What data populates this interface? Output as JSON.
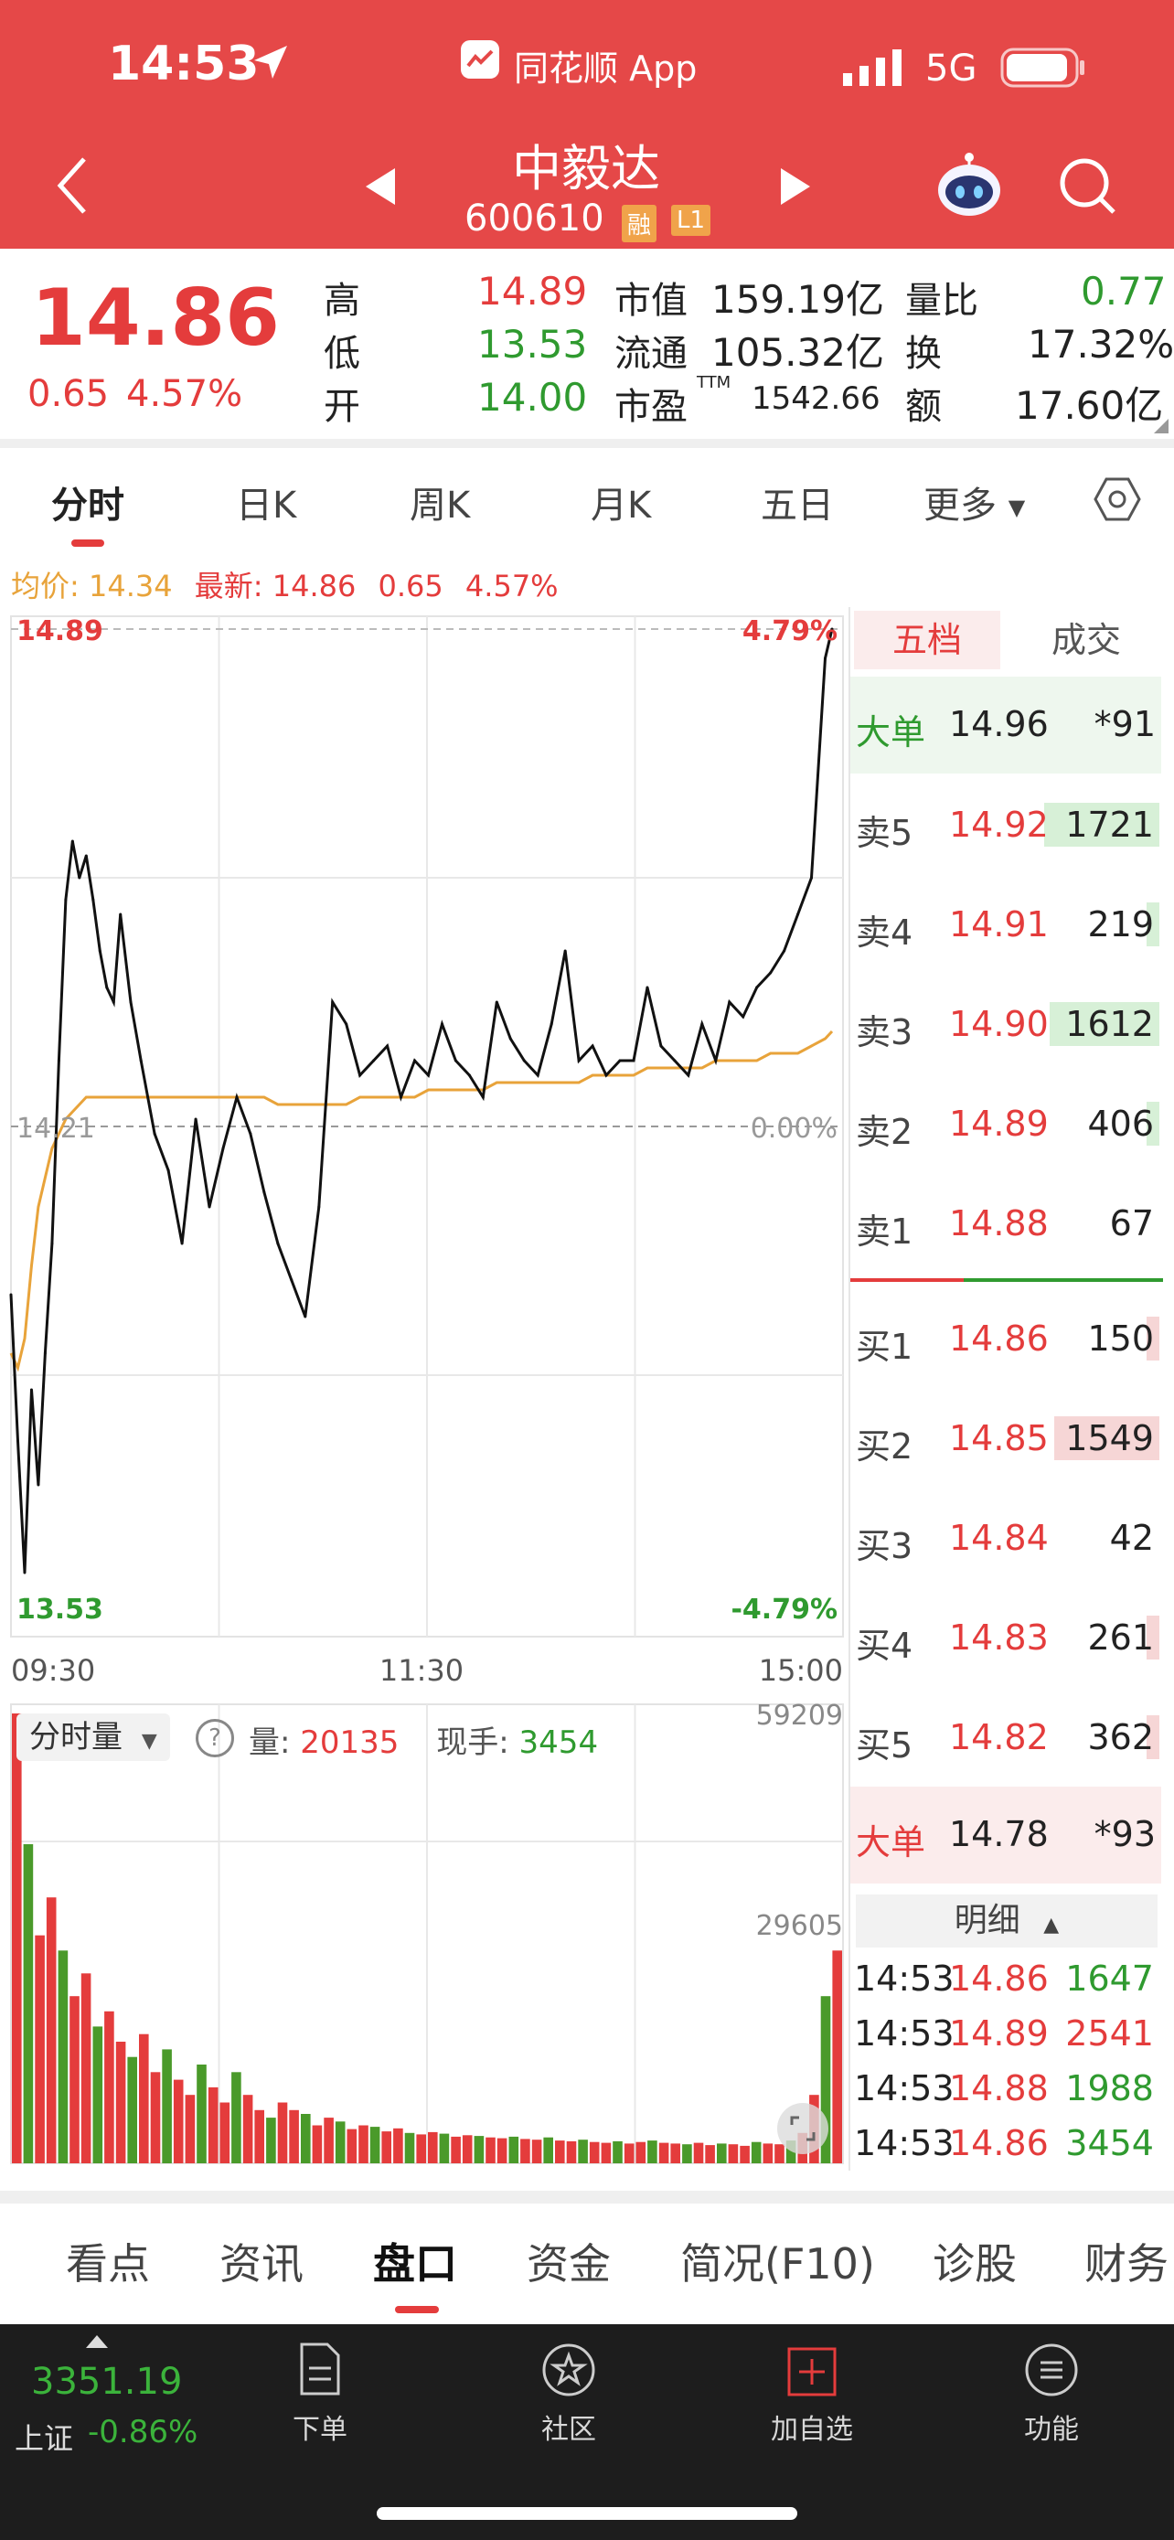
{
  "status_bar": {
    "time": "14:53",
    "app_label": "同花顺 App",
    "network": "5G"
  },
  "nav": {
    "stock_name": "中毅达",
    "stock_code": "600610",
    "badge_margin": "融",
    "badge_level": "L1"
  },
  "quote": {
    "price": "14.86",
    "change": "0.65",
    "change_pct": "4.57%",
    "high_label": "高",
    "high": "14.89",
    "low_label": "低",
    "low": "13.53",
    "open_label": "开",
    "open": "14.00",
    "mcap_label": "市值",
    "mcap": "159.19亿",
    "float_label": "流通",
    "float": "105.32亿",
    "pe_label": "市盈",
    "pe_sup": "TTM",
    "pe": "1542.66",
    "vr_label": "量比",
    "vr": "0.77",
    "turnover_label": "换",
    "turnover": "17.32%",
    "amount_label": "额",
    "amount": "17.60亿"
  },
  "chart_tabs": [
    "分时",
    "日K",
    "周K",
    "月K",
    "五日",
    "更多"
  ],
  "info_line": {
    "avg_label": "均价:",
    "avg": "14.34",
    "latest_label": "最新:",
    "latest": "14.86",
    "chg": "0.65",
    "pct": "4.57%"
  },
  "chart_data": {
    "type": "line",
    "price_axis": {
      "top": "14.89",
      "mid": "14.21",
      "bottom": "13.53",
      "pct_top": "4.79%",
      "pct_mid": "0.00%",
      "pct_bottom": "-4.79%",
      "ylim": [
        13.53,
        14.89
      ]
    },
    "time_labels": [
      "09:30",
      "11:30",
      "15:00"
    ],
    "x": [
      0,
      2,
      4,
      6,
      8,
      10,
      12,
      14,
      16,
      18,
      20,
      22,
      24,
      26,
      28,
      30,
      32,
      35,
      38,
      42,
      46,
      50,
      54,
      58,
      62,
      66,
      70,
      74,
      78,
      82,
      86,
      90,
      94,
      98,
      102,
      106,
      110,
      114,
      118,
      122,
      126,
      130,
      134,
      138,
      142,
      146,
      150,
      154,
      158,
      162,
      166,
      170,
      174,
      178,
      182,
      186,
      190,
      194,
      198,
      202,
      206,
      210,
      214,
      218,
      222,
      226,
      230,
      234,
      238,
      240
    ],
    "price": [
      13.98,
      13.78,
      13.6,
      13.85,
      13.72,
      13.9,
      14.05,
      14.3,
      14.52,
      14.6,
      14.55,
      14.58,
      14.52,
      14.45,
      14.4,
      14.38,
      14.5,
      14.38,
      14.3,
      14.2,
      14.15,
      14.05,
      14.22,
      14.1,
      14.18,
      14.25,
      14.2,
      14.12,
      14.05,
      14.0,
      13.95,
      14.1,
      14.38,
      14.35,
      14.28,
      14.3,
      14.32,
      14.25,
      14.3,
      14.28,
      14.35,
      14.3,
      14.28,
      14.25,
      14.38,
      14.33,
      14.3,
      14.28,
      14.35,
      14.45,
      14.3,
      14.32,
      14.28,
      14.3,
      14.3,
      14.4,
      14.32,
      14.3,
      14.28,
      14.35,
      14.3,
      14.38,
      14.36,
      14.4,
      14.42,
      14.45,
      14.5,
      14.55,
      14.85,
      14.89
    ],
    "avg": [
      13.9,
      13.88,
      13.92,
      14.02,
      14.1,
      14.14,
      14.18,
      14.2,
      14.22,
      14.23,
      14.24,
      14.25,
      14.25,
      14.25,
      14.25,
      14.25,
      14.25,
      14.25,
      14.25,
      14.25,
      14.25,
      14.25,
      14.25,
      14.25,
      14.25,
      14.25,
      14.25,
      14.25,
      14.24,
      14.24,
      14.24,
      14.24,
      14.24,
      14.24,
      14.25,
      14.25,
      14.25,
      14.25,
      14.25,
      14.26,
      14.26,
      14.26,
      14.26,
      14.26,
      14.27,
      14.27,
      14.27,
      14.27,
      14.27,
      14.27,
      14.27,
      14.28,
      14.28,
      14.28,
      14.28,
      14.29,
      14.29,
      14.29,
      14.29,
      14.29,
      14.3,
      14.3,
      14.3,
      14.3,
      14.31,
      14.31,
      14.31,
      14.32,
      14.33,
      14.34
    ],
    "price_series_name": "最新",
    "avg_series_name": "均价",
    "volume": {
      "label": "分时量",
      "vol_label": "量:",
      "vol": "20135",
      "hand_label": "现手:",
      "hand": "3454",
      "ymax": "59209",
      "ymid": "29605",
      "ylim": [
        0,
        59209
      ],
      "values": [
        59209,
        42000,
        30000,
        35000,
        28000,
        22000,
        25000,
        18000,
        20000,
        16000,
        14000,
        17000,
        12000,
        15000,
        11000,
        9000,
        13000,
        10000,
        8000,
        12000,
        9000,
        7000,
        6000,
        8000,
        7000,
        6500,
        5000,
        6000,
        5500,
        4500,
        5000,
        4800,
        4200,
        4600,
        4000,
        3800,
        4100,
        3900,
        3500,
        3700,
        3600,
        3400,
        3300,
        3500,
        3200,
        3100,
        3400,
        3000,
        2900,
        3100,
        2800,
        2700,
        2900,
        2600,
        2800,
        3000,
        2700,
        2600,
        2500,
        2700,
        2400,
        2600,
        2500,
        2300,
        2800,
        2600,
        2500,
        3000,
        4000,
        9000,
        22000,
        28000
      ],
      "colors_up": "#e43c3c",
      "colors_down": "#4a9a2a"
    }
  },
  "orderbook": {
    "tabs": [
      "五档",
      "成交"
    ],
    "big_sell": {
      "label": "大单",
      "price": "14.96",
      "qty": "*91"
    },
    "sells": [
      {
        "label": "卖5",
        "price": "14.92",
        "qty": "1721",
        "bar": 0.55
      },
      {
        "label": "卖4",
        "price": "14.91",
        "qty": "219",
        "bar": 0.06
      },
      {
        "label": "卖3",
        "price": "14.90",
        "qty": "1612",
        "bar": 0.52
      },
      {
        "label": "卖2",
        "price": "14.89",
        "qty": "406",
        "bar": 0.06
      },
      {
        "label": "卖1",
        "price": "14.88",
        "qty": "67",
        "bar": 0.0
      }
    ],
    "buys": [
      {
        "label": "买1",
        "price": "14.86",
        "qty": "150",
        "bar": 0.06
      },
      {
        "label": "买2",
        "price": "14.85",
        "qty": "1549",
        "bar": 0.5
      },
      {
        "label": "买3",
        "price": "14.84",
        "qty": "42",
        "bar": 0.0
      },
      {
        "label": "买4",
        "price": "14.83",
        "qty": "261",
        "bar": 0.06
      },
      {
        "label": "买5",
        "price": "14.82",
        "qty": "362",
        "bar": 0.06
      }
    ],
    "big_buy": {
      "label": "大单",
      "price": "14.78",
      "qty": "*93"
    },
    "detail_label": "明细",
    "ticks": [
      {
        "time": "14:53",
        "price": "14.86",
        "qty": "1647",
        "dir": "down"
      },
      {
        "time": "14:53",
        "price": "14.89",
        "qty": "2541",
        "dir": "up"
      },
      {
        "time": "14:53",
        "price": "14.88",
        "qty": "1988",
        "dir": "down"
      },
      {
        "time": "14:53",
        "price": "14.86",
        "qty": "3454",
        "dir": "down"
      }
    ]
  },
  "bottom_tabs": [
    "看点",
    "资讯",
    "盘口",
    "资金",
    "简况(F10)",
    "诊股",
    "财务"
  ],
  "footer": {
    "index_value": "3351.19",
    "index_name": "上证",
    "index_pct": "-0.86%",
    "buttons": [
      "下单",
      "社区",
      "加自选",
      "功能"
    ]
  },
  "colors": {
    "header_red": "#e54848",
    "up_red": "#e43c3c",
    "down_green": "#2f9a2f",
    "avg_line": "#e8a33a"
  }
}
